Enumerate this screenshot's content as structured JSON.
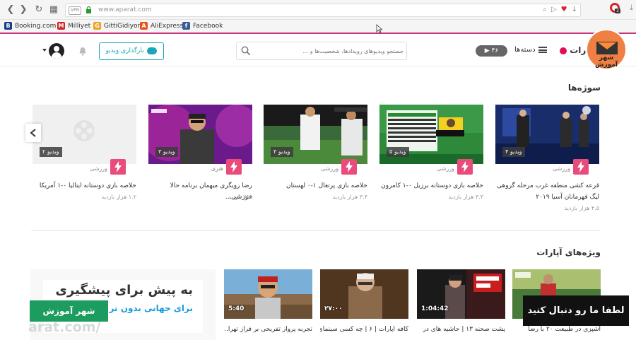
{
  "browser": {
    "vpn": "VPN",
    "url": "www.aparat.com",
    "bookmarks": [
      {
        "label": "Booking.com",
        "icon": "B",
        "color": "#1a3b8a"
      },
      {
        "label": "Milliyet",
        "icon": "M",
        "color": "#d32222"
      },
      {
        "label": "GittiGidiyor",
        "icon": "G",
        "color": "#f0a020"
      },
      {
        "label": "AliExpress",
        "icon": "A",
        "color": "#e8501a"
      },
      {
        "label": "Facebook",
        "icon": "f",
        "color": "#3b5998"
      }
    ],
    "opera_badge": "2"
  },
  "header": {
    "logo": "آپارات",
    "categories": "دسته‌ها",
    "live_count": "۴۶",
    "search_placeholder": "جستجو ویدیوهای رویدادها، شخصیت‌ها و ...",
    "upload": "بارگذاری ویدیو"
  },
  "watermark": {
    "circle_text": "شهر آموزش",
    "green_text": "شهر آموزش",
    "url_text": "arat.com/",
    "follow_text": "لطفا ما رو دنبال کنید"
  },
  "topics": {
    "title": "سوژه‌ها",
    "cards": [
      {
        "count": "۴ ویدیو",
        "category": "ورزشی",
        "title_line1": "قرعه کشی منطقه غرب مرحله گروهی",
        "title_line2": "لیگ قهرمانان آسیا ۲۰۱۹",
        "views": "۴.۵ هزار بازدید"
      },
      {
        "count": "۵ ویدیو",
        "category": "ورزشی",
        "title_line1": "خلاصه بازی دوستانه برزیل ۰-۱ کامرون",
        "title_line2": "",
        "views": "۳.۳ هزار بازدید"
      },
      {
        "count": "۳ ویدیو",
        "category": "ورزشی",
        "title_line1": "خلاصه بازی پرتغال ۱-۰ لهستان",
        "title_line2": "",
        "views": "۳.۴ هزار بازدید"
      },
      {
        "count": "۳ ویدیو",
        "category": "هنری",
        "title_line1": "رضا رویگری میهمان برنامه حالا خورشی...",
        "title_line2": "",
        "views": "۷۸۵ بازدید"
      },
      {
        "count": "۲ ویدیو",
        "category": "ورزشی",
        "title_line1": "خلاصه بازی دوستانه ایتالیا ۰-۱ آمریکا",
        "title_line2": "",
        "views": "۱.۲ هزار بازدید"
      }
    ]
  },
  "featured": {
    "title": "ویژه‌های آپارات",
    "cards": [
      {
        "duration": "",
        "title": "آشپزی در طبیعت ۲۰ با رضا"
      },
      {
        "duration": "1:04:42",
        "title": "پشت صحنه ۱۳ | حاشیه های در"
      },
      {
        "duration": "۲۷:۰۰",
        "title": "کافه آپارات | ۶ | چه کسی سینمای"
      },
      {
        "duration": "5:40",
        "title": "تجربه پرواز تفریحی بر فراز تهرا..."
      }
    ],
    "ad_line1": "به پیش برای پیشگیری",
    "ad_line2": "برای جهانی بدون تر"
  }
}
